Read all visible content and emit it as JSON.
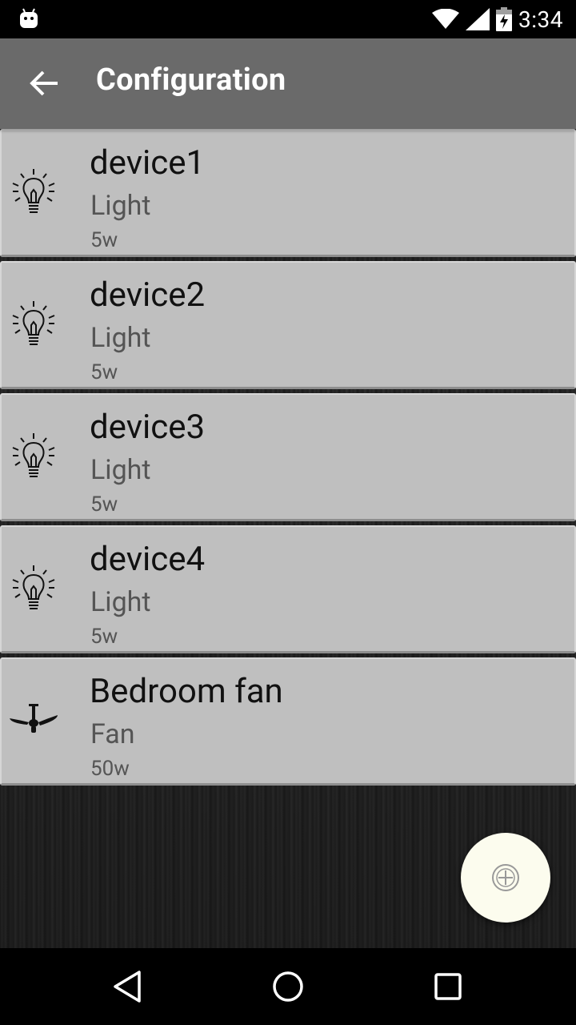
{
  "status_bar": {
    "time": "3:34",
    "icons": [
      "android-icon",
      "wifi-icon",
      "signal-icon",
      "battery-charging-icon"
    ]
  },
  "app_bar": {
    "title": "Configuration",
    "back_icon": "arrow-back-icon"
  },
  "devices": [
    {
      "name": "device1",
      "type": "Light",
      "power": "5w",
      "icon": "lightbulb-icon"
    },
    {
      "name": "device2",
      "type": "Light",
      "power": "5w",
      "icon": "lightbulb-icon"
    },
    {
      "name": "device3",
      "type": "Light",
      "power": "5w",
      "icon": "lightbulb-icon"
    },
    {
      "name": "device4",
      "type": "Light",
      "power": "5w",
      "icon": "lightbulb-icon"
    },
    {
      "name": "Bedroom fan",
      "type": "Fan",
      "power": "50w",
      "icon": "ceiling-fan-icon"
    }
  ],
  "fab": {
    "icon": "add-circle-icon"
  },
  "nav_bar": {
    "icons": [
      "back-triangle-icon",
      "home-circle-icon",
      "recents-square-icon"
    ]
  },
  "colors": {
    "app_bar": "#6a6a6a",
    "card": "#bfbfbf",
    "fab": "#fcfcee",
    "background": "#222222"
  }
}
